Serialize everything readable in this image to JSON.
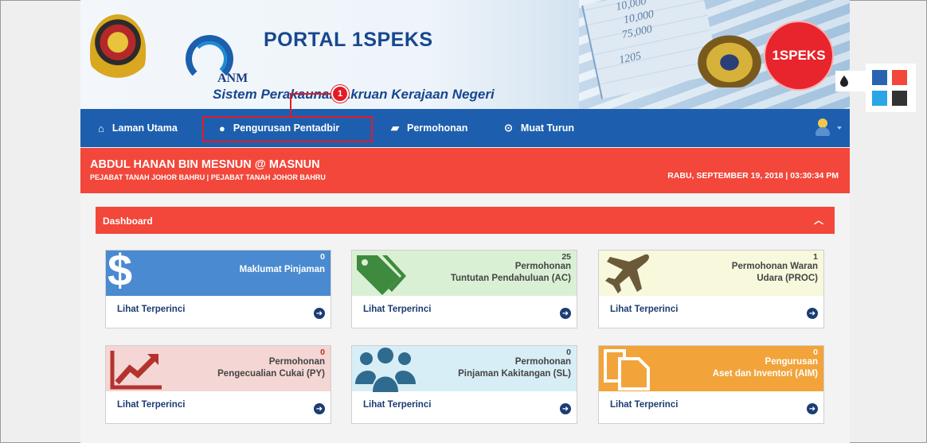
{
  "header": {
    "portal_title": "PORTAL 1SPEKS",
    "portal_subtitle": "Sistem Perakaunan Akruan Kerajaan Negeri",
    "anm_label": "ANM",
    "brand_logo_text": "1SPEKS",
    "sheet_numbers": [
      "10,000",
      "10,000",
      "75,000",
      "1205"
    ]
  },
  "nav": {
    "items": [
      {
        "label": "Laman Utama",
        "icon": "home-icon"
      },
      {
        "label": "Pengurusan Pentadbir",
        "icon": "user-icon"
      },
      {
        "label": "Permohonan",
        "icon": "book-icon"
      },
      {
        "label": "Muat Turun",
        "icon": "download-icon"
      }
    ]
  },
  "annotation": {
    "badge": "1"
  },
  "user": {
    "name": "ABDUL HANAN BIN MESNUN @ MASNUN",
    "office": "PEJABAT TANAH JOHOR BAHRU | PEJABAT TANAH JOHOR BAHRU",
    "datetime": "RABU, SEPTEMBER 19, 2018 | 03:30:34 PM"
  },
  "dashboard": {
    "title": "Dashboard",
    "collapse_icon": "chevron-up-icon",
    "cards": [
      {
        "count": "0",
        "title_lines": [
          "Maklumat Pinjaman"
        ],
        "link": "Lihat Terperinci",
        "icon": "dollar-icon",
        "color": "#4a8ad0"
      },
      {
        "count": "25",
        "title_lines": [
          "Permohonan",
          "Tuntutan Pendahuluan (AC)"
        ],
        "link": "Lihat Terperinci",
        "icon": "tag-icon",
        "color": "#daf0d4"
      },
      {
        "count": "1",
        "title_lines": [
          "Permohonan Waran",
          "Udara (PROC)"
        ],
        "link": "Lihat Terperinci",
        "icon": "plane-icon",
        "color": "#f7f8dc"
      },
      {
        "count": "0",
        "title_lines": [
          "Permohonan",
          "Pengecualian Cukai (PY)"
        ],
        "link": "Lihat Terperinci",
        "icon": "chart-line-icon",
        "color": "#f4d6d4"
      },
      {
        "count": "0",
        "title_lines": [
          "Permohonan",
          "Pinjaman Kakitangan (SL)"
        ],
        "link": "Lihat Terperinci",
        "icon": "users-icon",
        "color": "#d7eef7"
      },
      {
        "count": "0",
        "title_lines": [
          "Pengurusan",
          "Aset dan Inventori (AIM)"
        ],
        "link": "Lihat Terperinci",
        "icon": "copy-icon",
        "color": "#f2a33a"
      }
    ],
    "link_arrow_icon": "arrow-circle-right-icon"
  },
  "theme_panel": {
    "swatches": [
      "#2b63b3",
      "#f2473a",
      "#2aa6e6",
      "#333333"
    ],
    "toggle_icon": "droplet-icon"
  }
}
